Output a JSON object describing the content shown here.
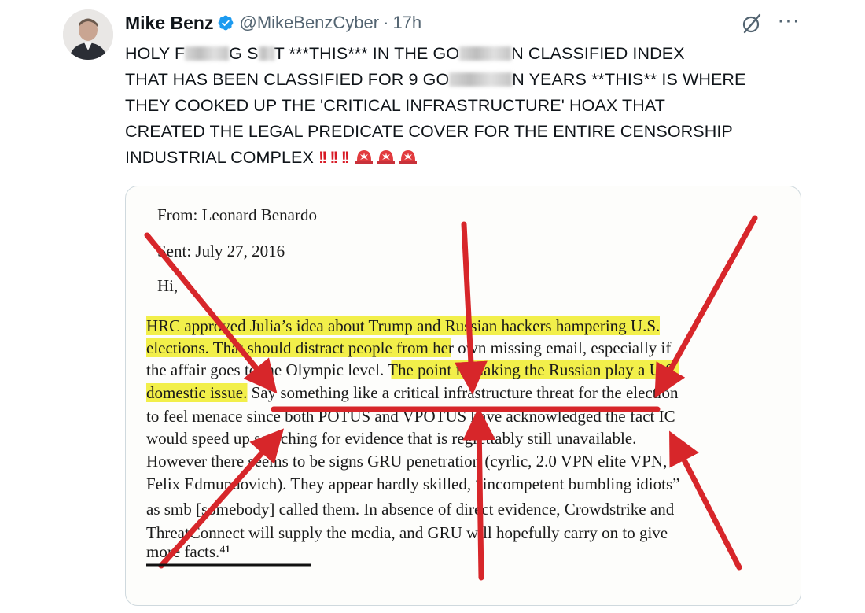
{
  "tweet": {
    "author_name": "Mike Benz",
    "handle": "@MikeBenzCyber",
    "separator": "·",
    "time": "17h",
    "more_label": "···",
    "text_lines": [
      [
        "HOLY F",
        "G S",
        "T ***THIS*** IN THE GO",
        "N CLASSIFIED INDEX"
      ],
      [
        "THAT HAS BEEN CLASSIFIED FOR 9 GO",
        "N YEARS **THIS** IS WHERE"
      ],
      [
        "THEY COOKED UP THE 'CRITICAL INFRASTRUCTURE' HOAX THAT"
      ],
      [
        "CREATED THE LEGAL PREDICATE COVER FOR THE ENTIRE CENSORSHIP"
      ],
      [
        "INDUSTRIAL COMPLEX"
      ]
    ],
    "bang_emoji": "‼️",
    "siren_emoji": "🚨"
  },
  "document": {
    "from": "From: Leonard Benardo",
    "sent": "Sent: July 27, 2016",
    "greeting": "Hi,",
    "body_lines": [
      "HRC approved Julia’s idea about Trump and Russian hackers hampering U.S.",
      "elections. That should distract people from her own missing email, especially if",
      "the affair goes to the Olympic level. The point is making the Russian play a U.S.",
      "domestic issue. Say something like a critical infrastructure threat for the election",
      "to feel menace since both POTUS and VPOTUS have acknowledged the fact IC",
      "would speed up searching for evidence that is regrettably still unavailable.",
      "However there seems to be signs GRU penetration (cyrlic, 2.0 VPN elite VPN,",
      "Felix Edmundovich). They appear hardly skilled, “incompetent bumbling idiots”",
      "as smb [somebody] called them. In absence of direct evidence, Crowdstrike and",
      "ThreatConnect will supply the media, and GRU will hopefully carry on to give",
      "more facts.⁴¹"
    ]
  },
  "colors": {
    "highlight": "#f2ef4a",
    "arrow_red": "#d7262a",
    "verified_blue": "#1d9bf0"
  }
}
